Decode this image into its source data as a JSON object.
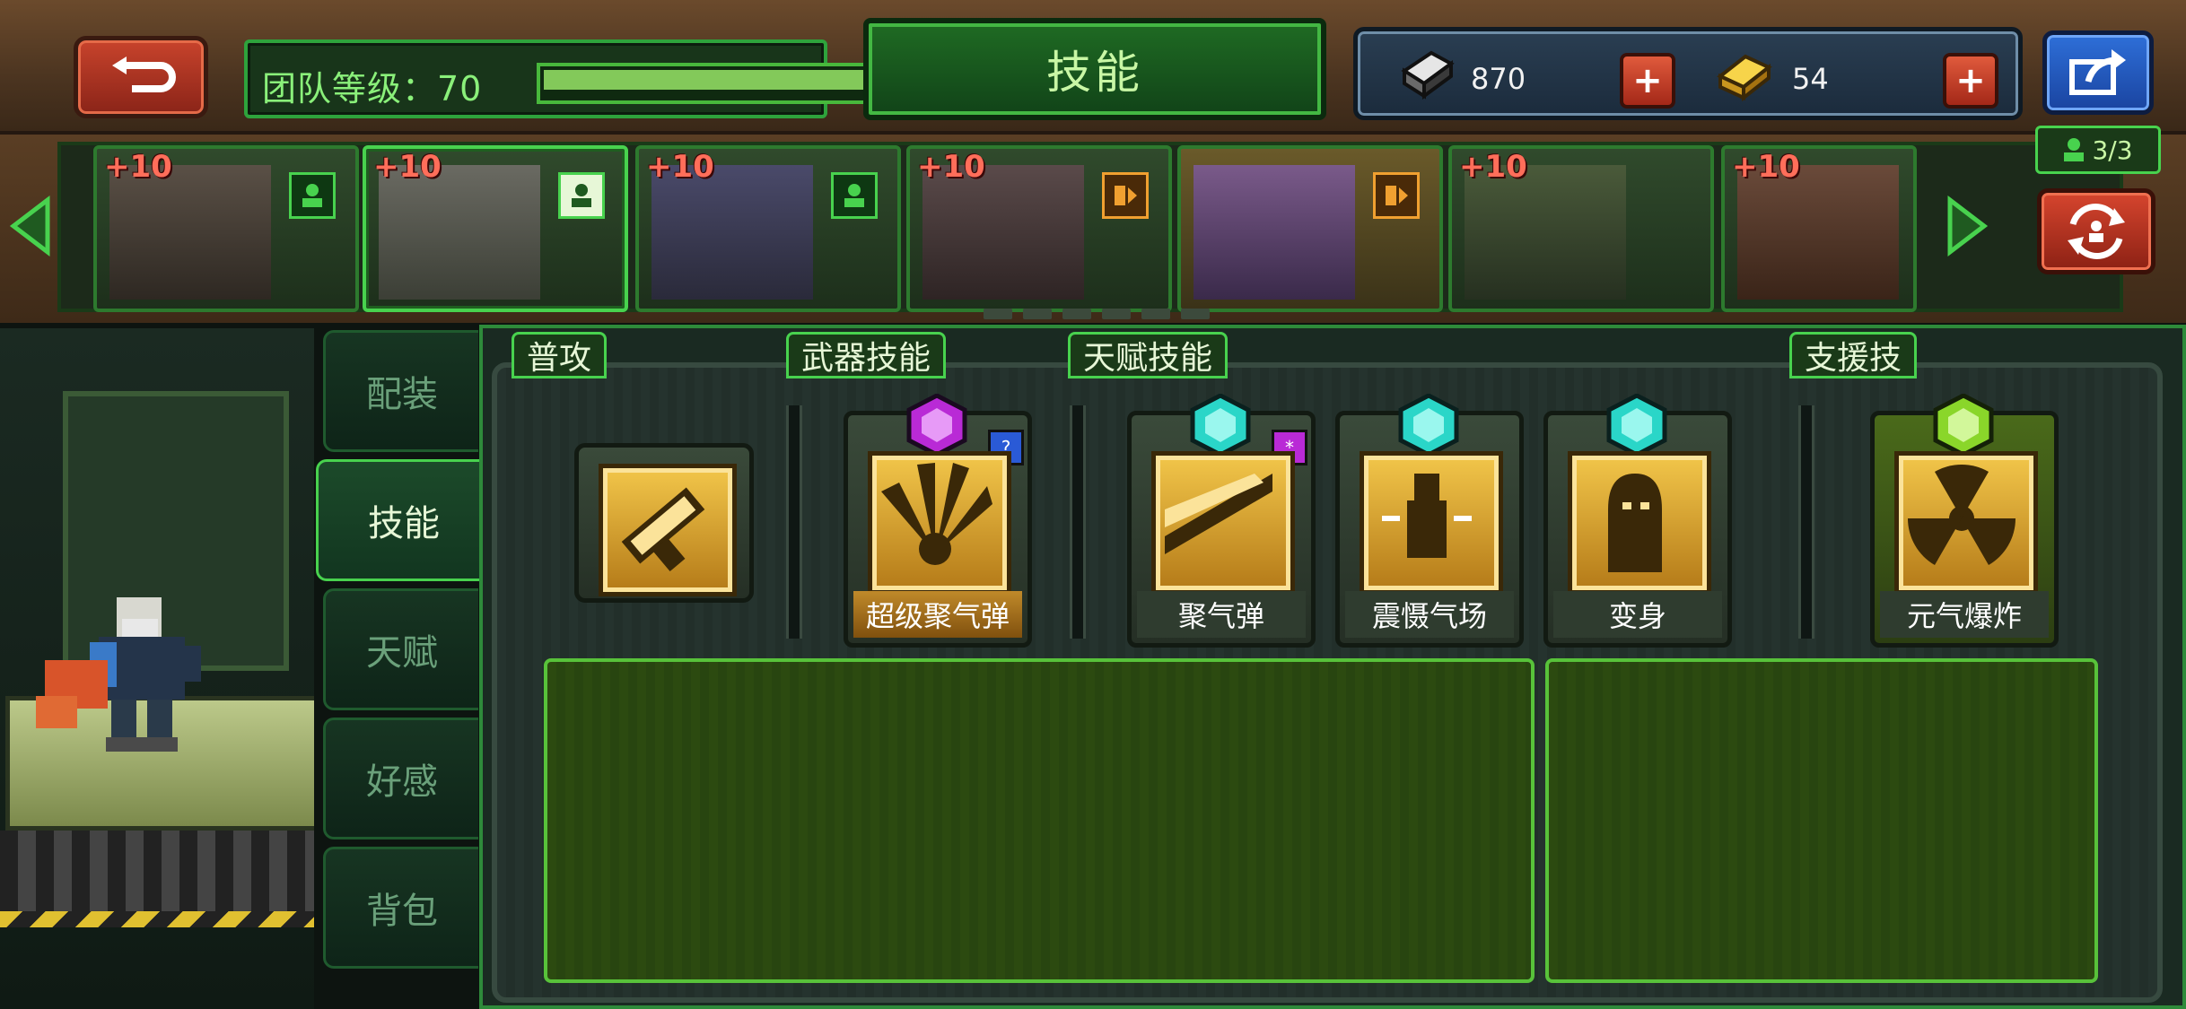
{
  "header": {
    "back_icon": "return-arrow-icon",
    "team_level_label": "团队等级：70",
    "team_level_progress": 1.0,
    "title": "技能",
    "currencies": [
      {
        "icon": "iron-chip-icon",
        "value": "870"
      },
      {
        "icon": "gold-bar-icon",
        "value": "54"
      }
    ],
    "share_icon": "share-icon"
  },
  "hero_roster": {
    "team_count": "3/3",
    "heroes": [
      {
        "bonus": "+10",
        "role_icon": "member-icon",
        "selected": false
      },
      {
        "bonus": "+10",
        "role_icon": "member-icon",
        "selected": true
      },
      {
        "bonus": "+10",
        "role_icon": "member-icon",
        "selected": false
      },
      {
        "bonus": "+10",
        "role_icon": "swap-in-icon",
        "selected": false
      },
      {
        "bonus": "",
        "role_icon": "swap-in-icon",
        "selected": false
      },
      {
        "bonus": "+10",
        "role_icon": "",
        "selected": false
      },
      {
        "bonus": "+10",
        "role_icon": "",
        "selected": false
      }
    ]
  },
  "side_tabs": [
    {
      "label": "配装",
      "active": false
    },
    {
      "label": "技能",
      "active": true
    },
    {
      "label": "天赋",
      "active": false
    },
    {
      "label": "好感",
      "active": false
    },
    {
      "label": "背包",
      "active": false
    }
  ],
  "skills": {
    "sections": {
      "basic": "普攻",
      "weapon": "武器技能",
      "talent": "天赋技能",
      "support": "支援技"
    },
    "basic_attack": {
      "icon": "pistol-icon"
    },
    "weapon_skills": [
      {
        "name": "超级聚气弹",
        "gem_color": "#b92ad6",
        "badge": "?",
        "badge_color": "#2a5ad6"
      }
    ],
    "talent_skills": [
      {
        "name": "聚气弹",
        "gem_color": "#2ad6c8",
        "badge": "*",
        "badge_color": "#b92ad6"
      },
      {
        "name": "震慑气场",
        "gem_color": "#2ad6c8"
      },
      {
        "name": "变身",
        "gem_color": "#2ad6c8"
      }
    ],
    "support_skills": [
      {
        "name": "元气爆炸",
        "gem_color": "#8ad62a"
      }
    ]
  }
}
